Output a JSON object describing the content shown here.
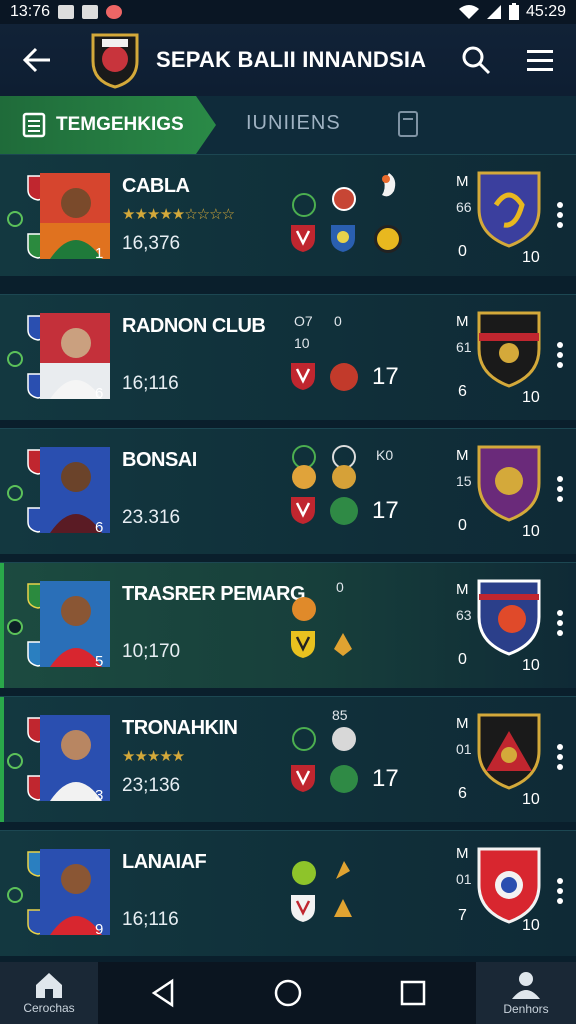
{
  "status": {
    "time": "13:76",
    "right_time": "45:29"
  },
  "header": {
    "title": "SEPAK BALII INNANDSIA"
  },
  "tabs": {
    "active": "TEMGEHKIGS",
    "second": "IUNIIENS"
  },
  "rows": [
    {
      "club": "CABLA",
      "stars": "★★★★★☆☆☆☆",
      "score": "16,376",
      "rank": "1",
      "extra": "",
      "col_m": "M",
      "col_m2": "66",
      "zero": "0",
      "ten": "10"
    },
    {
      "club": "RADNON CLUB",
      "stars": "",
      "score": "16;116",
      "rank": "6",
      "extra": "17",
      "a1": "O7",
      "a2": "0",
      "a3": "10",
      "col_m": "M",
      "col_m2": "61",
      "zero": "6",
      "ten": "10"
    },
    {
      "club": "BONSAI",
      "stars": "",
      "score": "23.316",
      "rank": "6",
      "extra": "17",
      "a1": "K0",
      "col_m": "M",
      "col_m2": "15",
      "zero": "0",
      "ten": "10"
    },
    {
      "club": "TRASRER PEMARG",
      "stars": "",
      "score": "10;170",
      "rank": "5",
      "extra": "",
      "a1": "0",
      "col_m": "M",
      "col_m2": "63",
      "zero": "0",
      "ten": "10"
    },
    {
      "club": "TRONAHKIN",
      "stars": "★★★★★",
      "score": "23;136",
      "rank": "3",
      "extra": "17",
      "a1": "85",
      "col_m": "M",
      "col_m2": "01",
      "zero": "6",
      "ten": "10"
    },
    {
      "club": "LANAIAF",
      "stars": "",
      "score": "16;116",
      "rank": "9",
      "extra": "",
      "col_m": "M",
      "col_m2": "01",
      "zero": "7",
      "ten": "10"
    }
  ],
  "bottom": {
    "left_label": "Cerochas",
    "right_label": "Denhors"
  },
  "colors": {
    "accent_green": "#2a8a47",
    "gold": "#d4a93a",
    "background": "#0a1f2c"
  }
}
